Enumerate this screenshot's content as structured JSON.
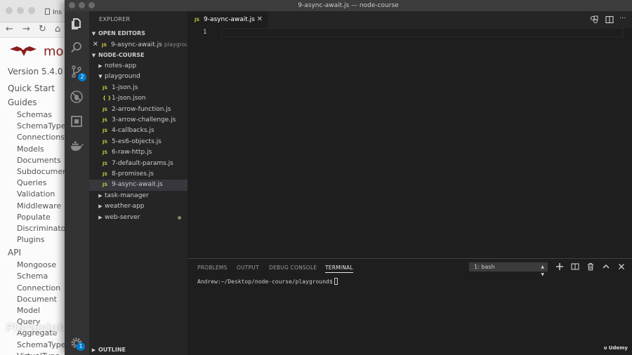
{
  "browser": {
    "tab_label": "Ins",
    "logo_text": "mo",
    "version": "Version 5.4.0",
    "nav": [
      {
        "label": "Quick Start",
        "level": "h"
      },
      {
        "label": "Guides",
        "level": "h"
      },
      {
        "label": "Schemas",
        "level": "s"
      },
      {
        "label": "SchemaTypes",
        "level": "s"
      },
      {
        "label": "Connections",
        "level": "s"
      },
      {
        "label": "Models",
        "level": "s"
      },
      {
        "label": "Documents",
        "level": "s"
      },
      {
        "label": "Subdocuments",
        "level": "s"
      },
      {
        "label": "Queries",
        "level": "s"
      },
      {
        "label": "Validation",
        "level": "s"
      },
      {
        "label": "Middleware",
        "level": "s"
      },
      {
        "label": "Populate",
        "level": "s"
      },
      {
        "label": "Discriminators",
        "level": "s"
      },
      {
        "label": "Plugins",
        "level": "s"
      },
      {
        "label": "API",
        "level": "h"
      },
      {
        "label": "Mongoose",
        "level": "s"
      },
      {
        "label": "Schema",
        "level": "s"
      },
      {
        "label": "Connection",
        "level": "s"
      },
      {
        "label": "Document",
        "level": "s"
      },
      {
        "label": "Model",
        "level": "s"
      },
      {
        "label": "Query",
        "level": "s"
      },
      {
        "label": "Aggregate",
        "level": "s"
      },
      {
        "label": "SchemaType",
        "level": "s"
      },
      {
        "label": "VirtualType",
        "level": "s"
      }
    ],
    "watermark": "Pluralsight"
  },
  "window": {
    "title": "9-async-await.js — node-course"
  },
  "activity_bar": {
    "scm_badge": "2",
    "settings_badge": "1",
    "icons": [
      "files-icon",
      "search-icon",
      "source-control-icon",
      "debug-icon",
      "extensions-icon",
      "docker-icon",
      "gear-icon"
    ]
  },
  "explorer": {
    "title": "EXPLORER",
    "open_editors_label": "OPEN EDITORS",
    "open_editor": {
      "name": "9-async-await.js",
      "path": "playground"
    },
    "folder_label": "NODE-COURSE",
    "outline_label": "OUTLINE",
    "tree": [
      {
        "name": "notes-app",
        "type": "folder",
        "open": false
      },
      {
        "name": "playground",
        "type": "folder",
        "open": true
      },
      {
        "name": "1-json.js",
        "type": "js"
      },
      {
        "name": "1-json.json",
        "type": "json"
      },
      {
        "name": "2-arrow-function.js",
        "type": "js"
      },
      {
        "name": "3-arrow-challenge.js",
        "type": "js"
      },
      {
        "name": "4-callbacks.js",
        "type": "js"
      },
      {
        "name": "5-es6-objects.js",
        "type": "js"
      },
      {
        "name": "6-raw-http.js",
        "type": "js"
      },
      {
        "name": "7-default-params.js",
        "type": "js"
      },
      {
        "name": "8-promises.js",
        "type": "js"
      },
      {
        "name": "9-async-await.js",
        "type": "js",
        "selected": true
      },
      {
        "name": "task-manager",
        "type": "folder",
        "open": false
      },
      {
        "name": "weather-app",
        "type": "folder",
        "open": false
      },
      {
        "name": "web-server",
        "type": "folder",
        "open": false,
        "modified": true
      }
    ]
  },
  "editor": {
    "tab_label": "9-async-await.js",
    "line_number": "1"
  },
  "panel": {
    "tabs": [
      "PROBLEMS",
      "OUTPUT",
      "DEBUG CONSOLE",
      "TERMINAL"
    ],
    "active_tab": "TERMINAL",
    "terminal_select": "1: bash",
    "prompt": "Andrew:~/Desktop/node-course/playground$"
  },
  "branding": "Udemy",
  "colors": {
    "accent": "#007acc",
    "js_icon": "#cbcb41",
    "selection": "#37373d"
  }
}
